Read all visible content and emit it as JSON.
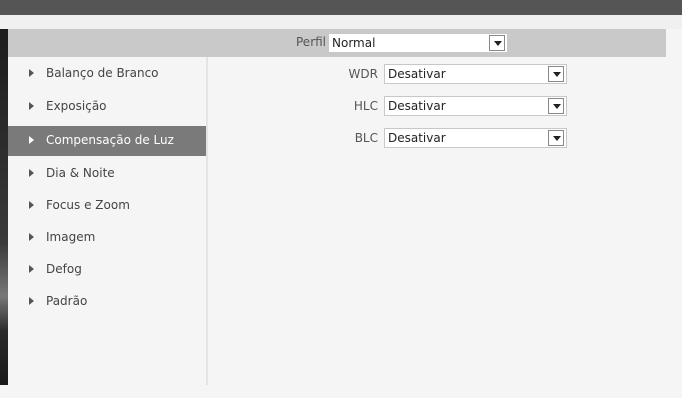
{
  "header": {
    "profile_label": "Perfil",
    "profile_value": "Normal"
  },
  "sidebar": {
    "items": [
      {
        "label": "Balanço de Branco"
      },
      {
        "label": "Exposição"
      },
      {
        "label": "Compensação de Luz",
        "active": true
      },
      {
        "label": "Dia & Noite"
      },
      {
        "label": "Focus e Zoom"
      },
      {
        "label": "Imagem"
      },
      {
        "label": "Defog"
      },
      {
        "label": "Padrão"
      }
    ]
  },
  "settings": {
    "wdr": {
      "label": "WDR",
      "value": "Desativar"
    },
    "hlc": {
      "label": "HLC",
      "value": "Desativar"
    },
    "blc": {
      "label": "BLC",
      "value": "Desativar"
    }
  },
  "colors": {
    "active_item_bg": "#7a7a7a",
    "profile_bar_bg": "#c9c9c9",
    "top_bar_bg": "#555555"
  }
}
